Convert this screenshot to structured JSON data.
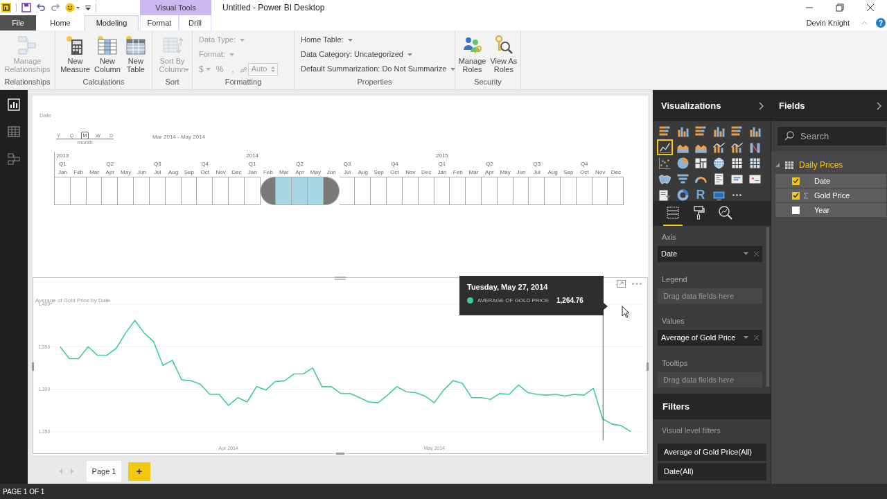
{
  "app": {
    "title": "Untitled - Power BI Desktop",
    "context_tab": "Visual Tools",
    "user": "Devin Knight",
    "help": "?"
  },
  "ribbon_tabs": [
    {
      "label": "File",
      "kind": "file",
      "selected": false
    },
    {
      "label": "Home",
      "kind": "tab",
      "selected": false
    },
    {
      "label": "Modeling",
      "kind": "tab",
      "selected": true
    },
    {
      "label": "Format",
      "kind": "context",
      "selected": false
    },
    {
      "label": "Drill",
      "kind": "context",
      "selected": false
    }
  ],
  "ribbon_groups": [
    {
      "label": "Relationships",
      "items": [
        {
          "kind": "large",
          "label": "Manage\nRelationships",
          "disabled": true,
          "dropdown": false
        }
      ]
    },
    {
      "label": "Calculations",
      "items": [
        {
          "kind": "large",
          "label": "New\nMeasure",
          "disabled": false,
          "dropdown": false
        },
        {
          "kind": "large",
          "label": "New\nColumn",
          "disabled": false,
          "dropdown": false
        },
        {
          "kind": "large",
          "label": "New\nTable",
          "disabled": false,
          "dropdown": false
        }
      ]
    },
    {
      "label": "Sort",
      "items": [
        {
          "kind": "large",
          "label": "Sort By\nColumn",
          "disabled": true,
          "dropdown": true
        }
      ]
    },
    {
      "label": "Formatting",
      "items": [
        {
          "kind": "dropdown",
          "label": "Data Type:",
          "disabled": true
        },
        {
          "kind": "dropdown",
          "label": "Format:",
          "disabled": true
        },
        {
          "kind": "format_row",
          "currency": "$",
          "percent": "%",
          "comma": ",",
          "spinner": "Auto",
          "disabled": true
        }
      ]
    },
    {
      "label": "Properties",
      "items": [
        {
          "kind": "dropdown",
          "label": "Home Table:",
          "disabled": false
        },
        {
          "kind": "dropdown",
          "label": "Data Category: Uncategorized",
          "disabled": false
        },
        {
          "kind": "dropdown",
          "label": "Default Summarization: Do Not Summarize",
          "disabled": false
        }
      ]
    },
    {
      "label": "Security",
      "items": [
        {
          "kind": "large",
          "label": "Manage\nRoles",
          "disabled": false,
          "dropdown": false
        },
        {
          "kind": "large",
          "label": "View As\nRoles",
          "disabled": false,
          "dropdown": false
        }
      ]
    }
  ],
  "left_nav": [
    {
      "kind": "report",
      "selected": true
    },
    {
      "kind": "data",
      "selected": false
    },
    {
      "kind": "relationships",
      "selected": false
    }
  ],
  "timeline": {
    "title": "Date",
    "granularity": [
      {
        "label": "Y",
        "selected": false
      },
      {
        "label": "Q",
        "selected": false
      },
      {
        "label": "M",
        "selected": true
      },
      {
        "label": "W",
        "selected": false
      },
      {
        "label": "D",
        "selected": false
      }
    ],
    "granularity_caption": "month",
    "range_label": "Mar 2014 - May 2014",
    "months": [
      {
        "year": "2013",
        "quarter": "Q1",
        "month": "Jan",
        "selected": false
      },
      {
        "month": "Feb",
        "selected": false
      },
      {
        "month": "Mar",
        "selected": false
      },
      {
        "quarter": "Q2",
        "month": "Apr",
        "selected": false
      },
      {
        "month": "May",
        "selected": false
      },
      {
        "month": "Jun",
        "selected": false
      },
      {
        "quarter": "Q3",
        "month": "Jul",
        "selected": false
      },
      {
        "month": "Aug",
        "selected": false
      },
      {
        "month": "Sep",
        "selected": false
      },
      {
        "quarter": "Q4",
        "month": "Oct",
        "selected": false
      },
      {
        "month": "Nov",
        "selected": false
      },
      {
        "month": "Dec",
        "selected": false
      },
      {
        "year": "2014",
        "quarter": "Q1",
        "month": "Jan",
        "selected": false
      },
      {
        "month": "Feb",
        "selected": false
      },
      {
        "month": "Mar",
        "selected": true
      },
      {
        "quarter": "Q2",
        "month": "Apr",
        "selected": true
      },
      {
        "month": "May",
        "selected": true
      },
      {
        "month": "Jun",
        "selected": false
      },
      {
        "quarter": "Q3",
        "month": "Jul",
        "selected": false
      },
      {
        "month": "Aug",
        "selected": false
      },
      {
        "month": "Sep",
        "selected": false
      },
      {
        "quarter": "Q4",
        "month": "Oct",
        "selected": false
      },
      {
        "month": "Nov",
        "selected": false
      },
      {
        "month": "Dec",
        "selected": false
      },
      {
        "year": "2015",
        "quarter": "Q1",
        "month": "Jan",
        "selected": false
      },
      {
        "month": "Feb",
        "selected": false
      },
      {
        "month": "Mar",
        "selected": false
      },
      {
        "quarter": "Q2",
        "month": "Apr",
        "selected": false
      },
      {
        "month": "May",
        "selected": false
      },
      {
        "month": "Jun",
        "selected": false
      },
      {
        "quarter": "Q3",
        "month": "Jul",
        "selected": false
      },
      {
        "month": "Aug",
        "selected": false
      },
      {
        "month": "Sep",
        "selected": false
      },
      {
        "quarter": "Q4",
        "month": "Oct",
        "selected": false
      },
      {
        "month": "Nov",
        "selected": false
      },
      {
        "month": "Dec",
        "selected": false
      }
    ]
  },
  "line_chart": {
    "chart_data": {
      "type": "line",
      "title": "Average of Gold Price by Date",
      "categories": [
        null,
        null,
        null,
        null,
        null,
        null,
        null,
        null,
        null,
        null,
        null,
        null,
        null,
        null,
        null,
        null,
        null,
        null,
        "Apr 2014",
        null,
        null,
        null,
        null,
        null,
        null,
        null,
        null,
        null,
        null,
        null,
        null,
        null,
        null,
        null,
        null,
        null,
        null,
        null,
        null,
        null,
        "May 2014",
        null,
        null,
        null,
        null,
        null,
        null,
        null,
        null,
        null,
        null,
        null,
        null,
        null,
        null,
        null,
        null,
        null,
        null,
        null,
        null,
        null
      ],
      "series": [
        {
          "color": "#3fc9a5",
          "values": [
            1350,
            1336,
            1336,
            1350,
            1340,
            1340,
            1348,
            1366,
            1381,
            1366,
            1356,
            1328,
            1334,
            1311,
            1310,
            1306,
            1294,
            1294,
            1281,
            1290,
            1285,
            1303,
            1299,
            1309,
            1310,
            1318,
            1318,
            1325,
            1303,
            1303,
            1295,
            1295,
            1290,
            1285,
            1284,
            1293,
            1303,
            1297,
            1296,
            1292,
            1284,
            1299,
            1310,
            1307,
            1290,
            1290,
            1288,
            1295,
            1294,
            1305,
            1296,
            1294,
            1293,
            1294,
            1292,
            1294,
            1293,
            1301,
            1265,
            1259,
            1257,
            1250
          ]
        }
      ],
      "ylim": [
        1240,
        1400
      ],
      "yticks": [
        {
          "value": 1250,
          "label": "1,250"
        },
        {
          "value": 1300,
          "label": "1,300"
        },
        {
          "value": 1350,
          "label": "1,350"
        },
        {
          "value": 1400,
          "label": "1,400"
        }
      ],
      "grid": true
    },
    "tooltip": {
      "title": "Tuesday, May 27, 2014",
      "label": "AVERAGE OF GOLD PRICE",
      "value": "1,264.76"
    }
  },
  "pages": {
    "tabs": [
      {
        "label": "Page 1",
        "selected": true
      }
    ],
    "add_button": "+"
  },
  "status_bar": "PAGE 1 OF 1",
  "visualizations": {
    "title": "Visualizations",
    "types": [
      {
        "kind": "bar",
        "selected": false
      },
      {
        "kind": "column",
        "selected": false
      },
      {
        "kind": "bar",
        "selected": false
      },
      {
        "kind": "column",
        "selected": false
      },
      {
        "kind": "bar",
        "selected": false
      },
      {
        "kind": "column",
        "selected": false
      },
      {
        "kind": "line",
        "selected": true
      },
      {
        "kind": "area",
        "selected": false
      },
      {
        "kind": "area",
        "selected": false
      },
      {
        "kind": "combo",
        "selected": false
      },
      {
        "kind": "combo",
        "selected": false
      },
      {
        "kind": "ribbon",
        "selected": false
      },
      {
        "kind": "scatter",
        "selected": false
      },
      {
        "kind": "pie",
        "selected": false
      },
      {
        "kind": "treemap",
        "selected": false
      },
      {
        "kind": "globe",
        "selected": false
      },
      {
        "kind": "table",
        "selected": false
      },
      {
        "kind": "matrix",
        "selected": false
      },
      {
        "kind": "filled_map",
        "selected": false
      },
      {
        "kind": "funnel",
        "selected": false
      },
      {
        "kind": "gauge",
        "selected": false
      },
      {
        "kind": "multi_card",
        "selected": false
      },
      {
        "kind": "card",
        "selected": false
      },
      {
        "kind": "kpi",
        "selected": false
      },
      {
        "kind": "slicer",
        "selected": false
      },
      {
        "kind": "donut",
        "selected": false
      },
      {
        "kind": "glyph",
        "glyph": "R",
        "selected": false
      },
      {
        "kind": "custom",
        "selected": false
      },
      {
        "kind": "more",
        "selected": false
      }
    ],
    "pane_tabs": [
      {
        "kind": "fields",
        "selected": true
      },
      {
        "kind": "format",
        "selected": false
      },
      {
        "kind": "analytics",
        "selected": false
      }
    ],
    "wells": [
      {
        "label": "Axis",
        "field": "Date"
      },
      {
        "label": "Legend",
        "placeholder": "Drag data fields here"
      },
      {
        "label": "Values",
        "field": "Average of Gold Price"
      },
      {
        "label": "Tooltips",
        "placeholder": "Drag data fields here"
      }
    ]
  },
  "filters": {
    "title": "Filters",
    "section": "Visual level filters",
    "items": [
      "Average of Gold Price(All)",
      "Date(All)"
    ]
  },
  "fields": {
    "title": "Fields",
    "search_placeholder": "Search",
    "tables": [
      {
        "name": "Daily Prices",
        "expanded": true,
        "fields": [
          {
            "name": "Date",
            "checked": true,
            "kind": "plain"
          },
          {
            "name": "Gold Price",
            "checked": true,
            "kind": "sum"
          },
          {
            "name": "Year",
            "checked": false,
            "kind": "plain"
          }
        ]
      }
    ]
  }
}
